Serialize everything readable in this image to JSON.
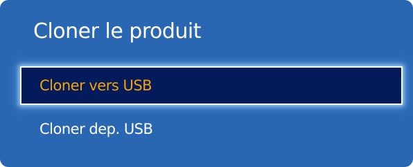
{
  "menu": {
    "title": "Cloner le produit",
    "items": [
      {
        "label": "Cloner vers USB",
        "selected": true
      },
      {
        "label": "Cloner dep. USB",
        "selected": false
      }
    ]
  },
  "colors": {
    "panel_background": "#2a67b3",
    "selected_background": "#031a5b",
    "selected_text": "#f4a20a",
    "text": "#ffffff",
    "focus_border": "#ffffff"
  }
}
